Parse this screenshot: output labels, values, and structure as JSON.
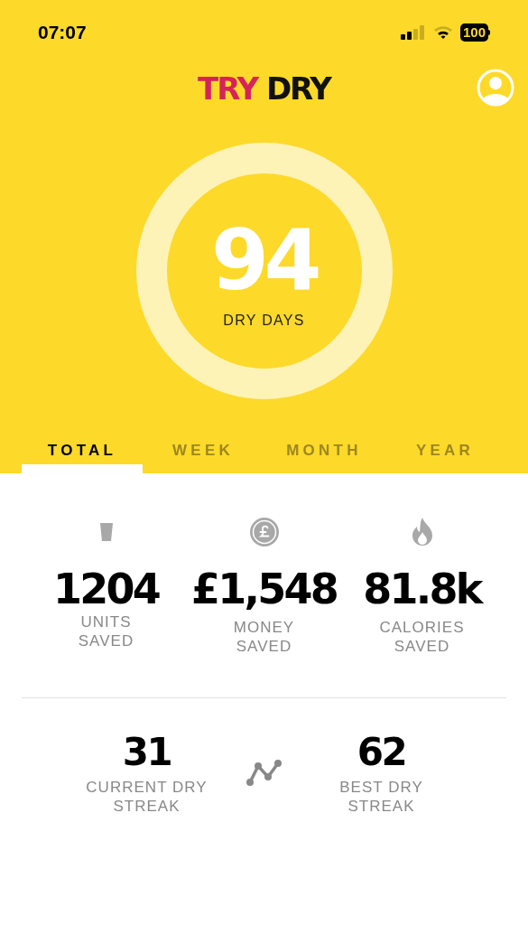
{
  "status_bar": {
    "time": "07:07",
    "battery": "100"
  },
  "header": {
    "title_parts": [
      {
        "text": "TRY",
        "color": "#d6245a"
      },
      {
        "text": "DRY",
        "color": "#111111"
      }
    ]
  },
  "counter": {
    "value": "94",
    "label": "DRY DAYS"
  },
  "tabs": [
    {
      "label": "TOTAL",
      "selected": true
    },
    {
      "label": "WEEK",
      "selected": false
    },
    {
      "label": "MONTH",
      "selected": false
    },
    {
      "label": "YEAR",
      "selected": false
    }
  ],
  "stats": [
    {
      "kind": "glass",
      "value": "1204",
      "label": "UNITS SAVED"
    },
    {
      "kind": "pound",
      "value": "£1,548",
      "label": "MONEY SAVED"
    },
    {
      "kind": "flame",
      "value": "81.8k",
      "label": "CALORIES SAVED"
    }
  ],
  "streaks": [
    {
      "value": "31",
      "label": "CURRENT DRY STREAK"
    },
    {
      "value": "62",
      "label": "BEST DRY STREAK"
    }
  ]
}
